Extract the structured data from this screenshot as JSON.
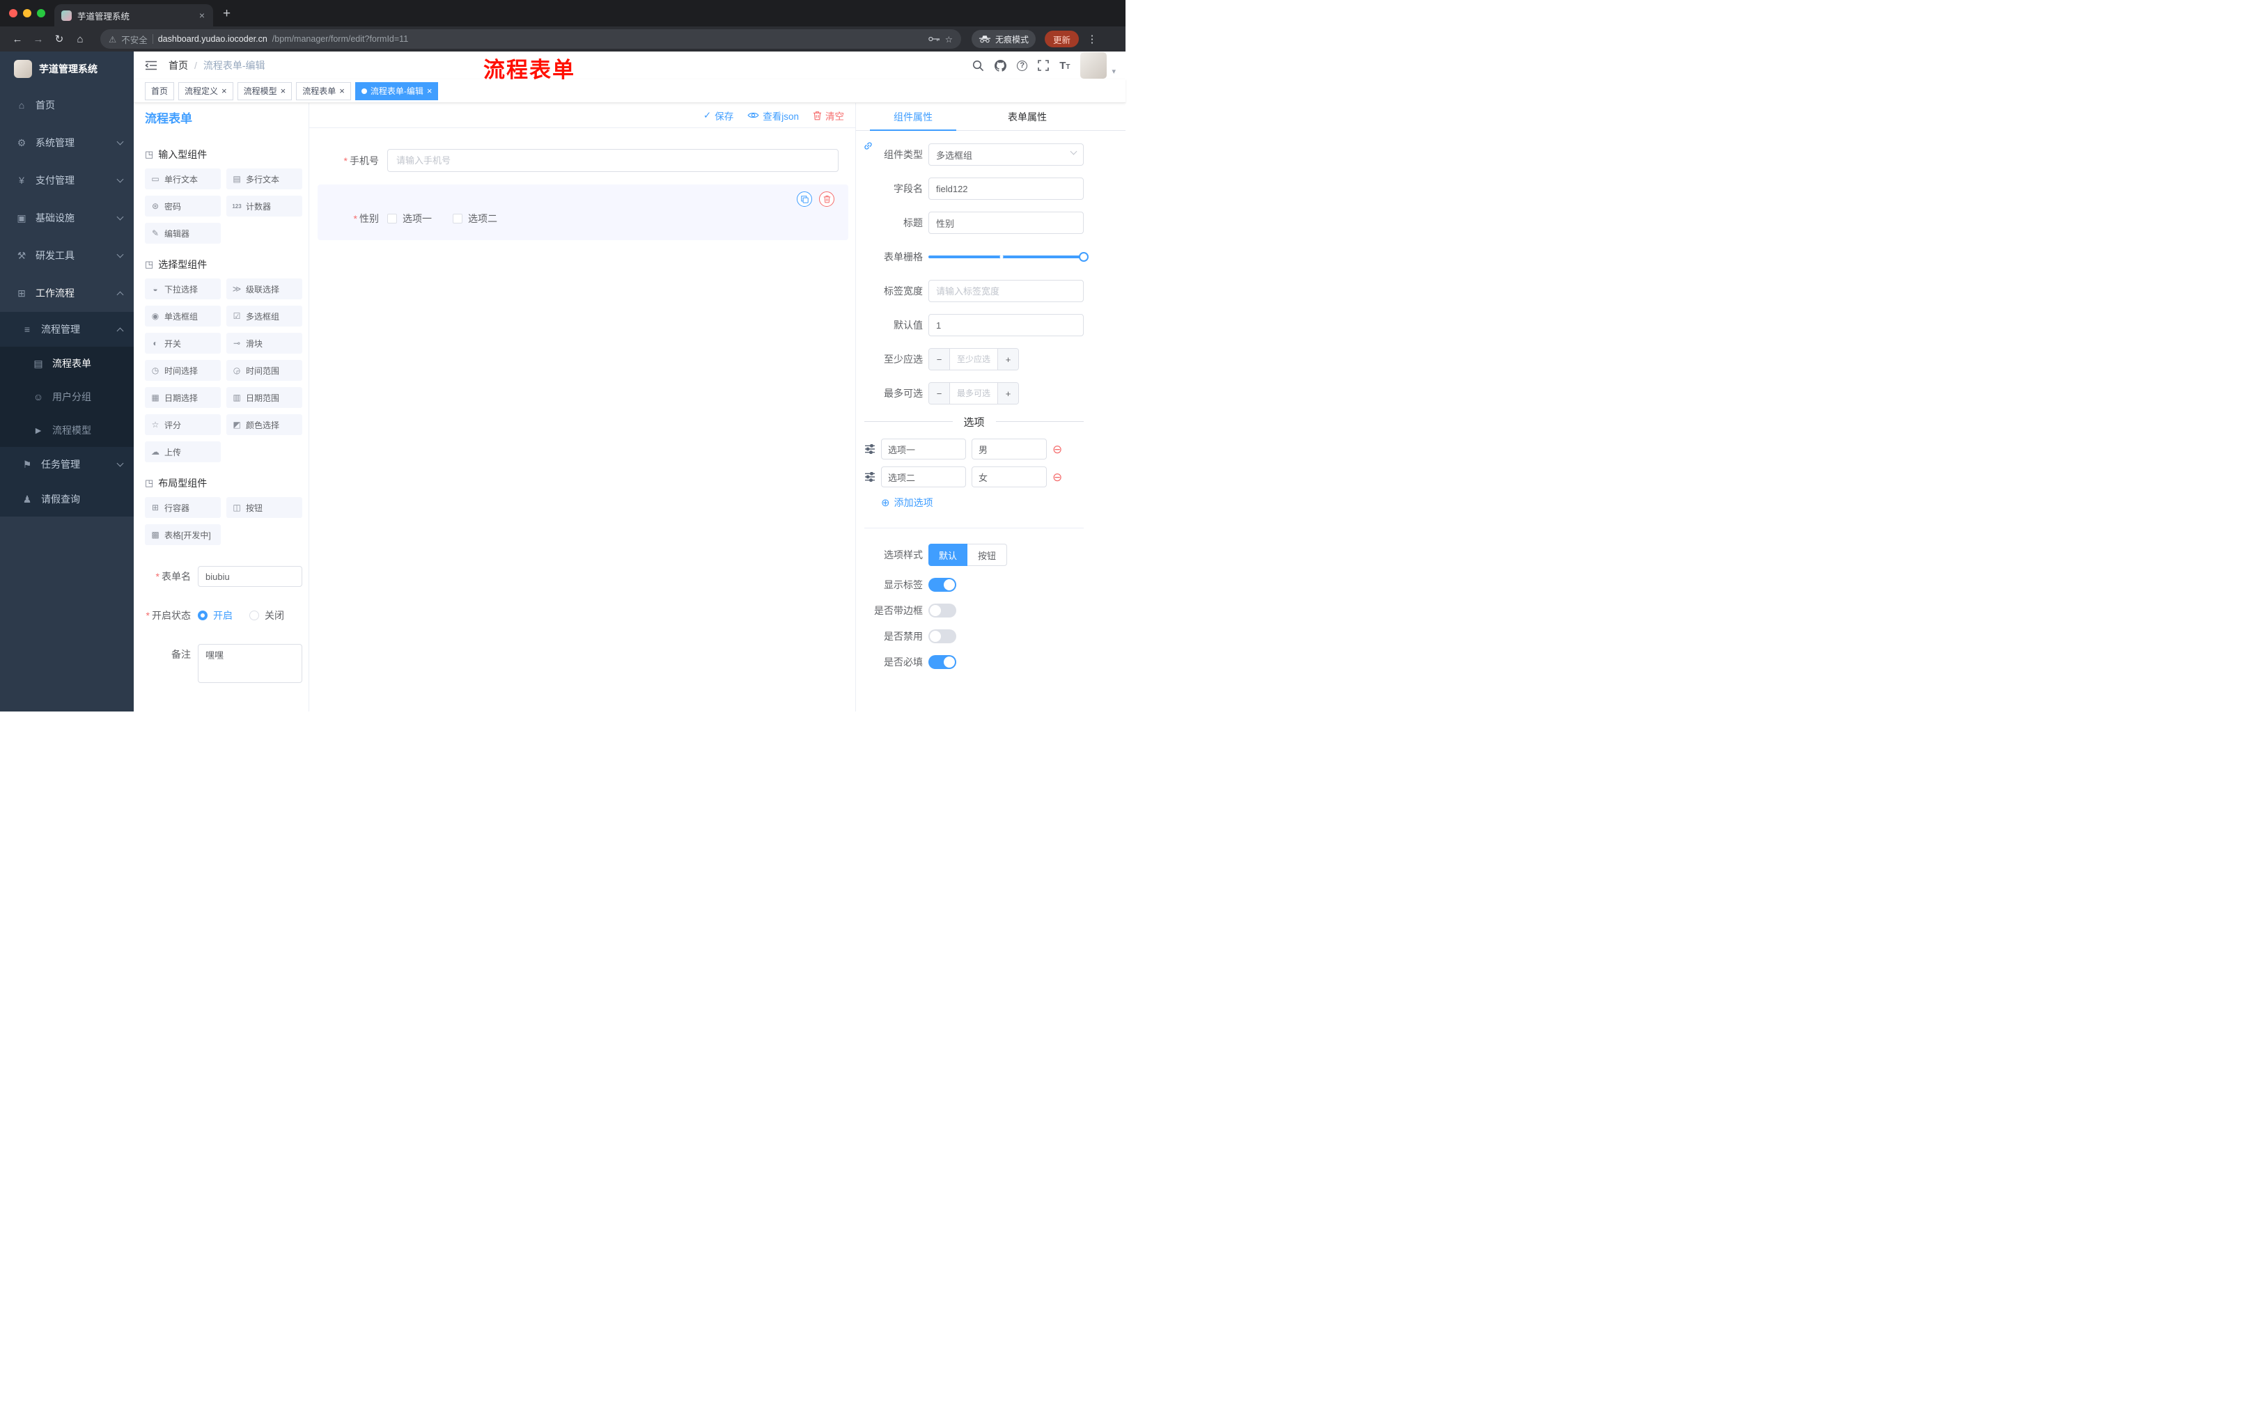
{
  "colors": {
    "accent": "#409eff",
    "danger": "#f56c6c",
    "annotation": "#ff1000",
    "sidebar_bg": "#2d3a4b"
  },
  "browser": {
    "tab_title": "芋道管理系统",
    "security_label": "不安全",
    "divider": "|",
    "url_host": "dashboard.yudao.iocoder.cn",
    "url_path": "/bpm/manager/form/edit?formId=11",
    "incognito_label": "无痕模式",
    "update_label": "更新"
  },
  "sidebar": {
    "logo_title": "芋道管理系统",
    "menu": [
      {
        "label": "首页"
      },
      {
        "label": "系统管理"
      },
      {
        "label": "支付管理"
      },
      {
        "label": "基础设施"
      },
      {
        "label": "研发工具"
      },
      {
        "label": "工作流程"
      },
      {
        "label": "流程管理"
      },
      {
        "label": "流程表单"
      },
      {
        "label": "用户分组"
      },
      {
        "label": "流程模型"
      },
      {
        "label": "任务管理"
      },
      {
        "label": "请假查询"
      }
    ]
  },
  "header": {
    "breadcrumb_root": "首页",
    "separator": "/",
    "breadcrumb_current": "流程表单-编辑",
    "annotation": "流程表单"
  },
  "tags": {
    "items": [
      {
        "label": "首页"
      },
      {
        "label": "流程定义"
      },
      {
        "label": "流程模型"
      },
      {
        "label": "流程表单"
      },
      {
        "label": "流程表单-编辑"
      }
    ]
  },
  "palette": {
    "title": "流程表单",
    "groups": [
      {
        "title": "输入型组件",
        "items": [
          {
            "label": "单行文本"
          },
          {
            "label": "多行文本"
          },
          {
            "label": "密码"
          },
          {
            "label": "计数器"
          },
          {
            "label": "编辑器"
          }
        ]
      },
      {
        "title": "选择型组件",
        "items": [
          {
            "label": "下拉选择"
          },
          {
            "label": "级联选择"
          },
          {
            "label": "单选框组"
          },
          {
            "label": "多选框组"
          },
          {
            "label": "开关"
          },
          {
            "label": "滑块"
          },
          {
            "label": "时间选择"
          },
          {
            "label": "时间范围"
          },
          {
            "label": "日期选择"
          },
          {
            "label": "日期范围"
          },
          {
            "label": "评分"
          },
          {
            "label": "颜色选择"
          },
          {
            "label": "上传"
          }
        ]
      },
      {
        "title": "布局型组件",
        "items": [
          {
            "label": "行容器"
          },
          {
            "label": "按钮"
          },
          {
            "label": "表格[开发中]"
          }
        ]
      }
    ],
    "form": {
      "name_label": "表单名",
      "name_value": "biubiu",
      "status_label": "开启状态",
      "status_on": "开启",
      "status_off": "关闭",
      "remark_label": "备注",
      "remark_value": "嘿嘿"
    }
  },
  "canvas": {
    "save": "保存",
    "view_json": "查看json",
    "clear": "清空",
    "phone_label": "手机号",
    "phone_placeholder": "请输入手机号",
    "gender_label": "性别",
    "gender_option1": "选项一",
    "gender_option2": "选项二"
  },
  "props": {
    "tab_component": "组件属性",
    "tab_form": "表单属性",
    "type_label": "组件类型",
    "type_value": "多选框组",
    "field_label": "字段名",
    "field_value": "field122",
    "title_label": "标题",
    "title_value": "性别",
    "grid_label": "表单栅格",
    "width_label": "标签宽度",
    "width_placeholder": "请输入标签宽度",
    "default_label": "默认值",
    "default_value": "1",
    "min_label": "至少应选",
    "min_placeholder": "至少应选",
    "max_label": "最多可选",
    "max_placeholder": "最多可选",
    "options_title": "选项",
    "options": [
      {
        "label": "选项一",
        "value": "男"
      },
      {
        "label": "选项二",
        "value": "女"
      }
    ],
    "add_option": "添加选项",
    "style_label": "选项样式",
    "style_default": "默认",
    "style_button": "按钮",
    "show_label": "显示标签",
    "border_label": "是否带边框",
    "disabled_label": "是否禁用",
    "required_label": "是否必填"
  },
  "icons": {
    "back": "←",
    "forward": "→",
    "reload": "↻",
    "home_nav": "⌂",
    "warning": "⚠",
    "star": "☆",
    "more_vert": "⋮",
    "new_tab": "+",
    "close": "×",
    "caret_down": "▾",
    "question": "?",
    "text_size": "T",
    "asterisk": "*",
    "minus": "−",
    "plus": "+",
    "remove_circle": "⊖",
    "add_circle": "⊕",
    "check": "✓",
    "dashboard": "⌂",
    "gear": "⚙",
    "yen": "¥",
    "infra": "▣",
    "tools": "⚒",
    "workflow": "⊞",
    "list": "≡",
    "doc": "▤",
    "users": "☺",
    "send": "►",
    "flag": "⚑",
    "person": "♟",
    "group_cube": "◳",
    "input": "▭",
    "textarea": "▤",
    "password": "⊛",
    "counter": "123",
    "editor": "✎",
    "select": "◒",
    "cascader": "≫",
    "radio": "◉",
    "checkbox": "☑",
    "switch": "◐",
    "slider": "⊸",
    "time": "◷",
    "time_range": "◶",
    "date": "▦",
    "date_range": "▥",
    "rate": "☆",
    "color": "◩",
    "upload": "☁",
    "row": "⊞",
    "button": "◫",
    "table": "▩"
  }
}
